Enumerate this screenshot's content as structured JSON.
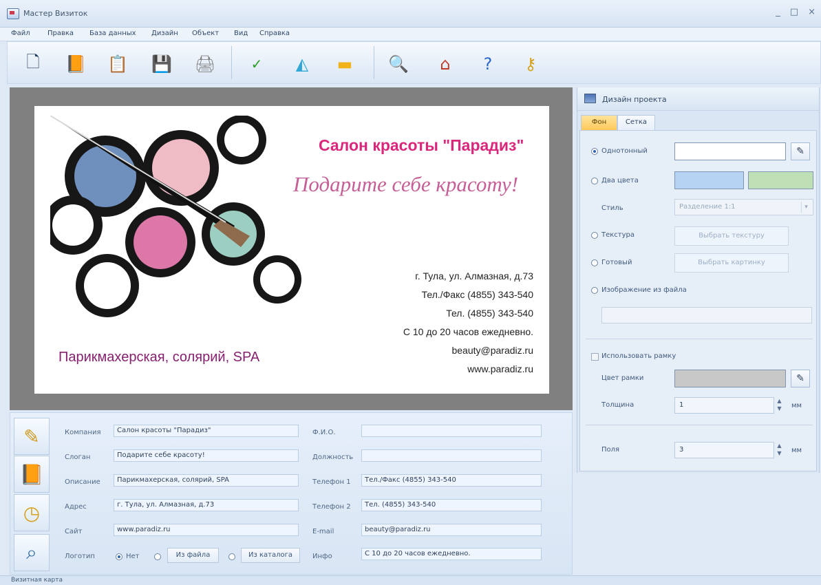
{
  "window": {
    "title": "Мастер Визиток",
    "minimize": "_",
    "maximize": "□",
    "close": "×"
  },
  "menu": [
    "Файл",
    "Правка",
    "База данных",
    "Дизайн",
    "Объект",
    "Вид",
    "Справка"
  ],
  "toolbar_icons": [
    "new-document-icon",
    "open-book-icon",
    "clipboard-icon",
    "save-icon",
    "print-icon",
    "spellcheck-icon",
    "shapes-icon",
    "image-icon",
    "zoom-icon",
    "home-icon",
    "help-icon",
    "keys-icon"
  ],
  "card": {
    "title": "Салон красоты \"Парадиз\"",
    "slogan": "Подарите себе красоту!",
    "description": "Парикмахерская, солярий, SPA",
    "address": "г. Тула, ул. Алмазная, д.73",
    "phone_fax": "Тел./Факс (4855) 343-540",
    "phone": "Тел. (4855) 343-540",
    "hours": "С 10 до 20 часов ежедневно.",
    "email": "beauty@paradiz.ru",
    "site": "www.paradiz.ru",
    "accent_color": "#d9277b",
    "slogan_color": "#c55f95",
    "desc_color": "#87206f"
  },
  "form": {
    "company_label": "Компания",
    "company": "Салон красоты \"Парадиз\"",
    "slogan_label": "Слоган",
    "slogan": "Подарите себе красоту!",
    "description_label": "Описание",
    "description": "Парикмахерская, солярий, SPA",
    "address_label": "Адрес",
    "address": "г. Тула, ул. Алмазная, д.73",
    "site_label": "Сайт",
    "site": "www.paradiz.ru",
    "logo_label": "Логотип",
    "logo_none": "Нет",
    "logo_file": "Из файла",
    "logo_catalog": "Из каталога",
    "fio_label": "Ф.И.О.",
    "fio": "",
    "position_label": "Должность",
    "position": "",
    "phone1_label": "Телефон 1",
    "phone1": "Тел./Факс (4855) 343-540",
    "phone2_label": "Телефон 2",
    "phone2": "Тел. (4855) 343-540",
    "email_label": "E-mail",
    "email": "beauty@paradiz.ru",
    "info_label": "Инфо",
    "info": "С 10 до 20 часов ежедневно."
  },
  "design_panel": {
    "title": "Дизайн проекта",
    "tabs": [
      "Фон",
      "Сетка"
    ],
    "solid": "Однотонный",
    "two_colors": "Два цвета",
    "style_label": "Стиль",
    "style_value": "Разделение 1:1",
    "texture": "Текстура",
    "choose_texture": "Выбрать текстуру",
    "ready": "Готовый",
    "choose_picture": "Выбрать картинку",
    "file_image": "Изображение из файла",
    "use_frame": "Использовать рамку",
    "frame_color": "Цвет рамки",
    "thickness": "Толщина",
    "thickness_value": "1",
    "unit_mm": "мм",
    "margins": "Поля",
    "margins_value": "3",
    "color_white": "#ffffff",
    "color_blue": "#b7d3f4",
    "color_green": "#bfe0b7",
    "color_gray": "#c8c8c8"
  },
  "status": "Визитная карта"
}
